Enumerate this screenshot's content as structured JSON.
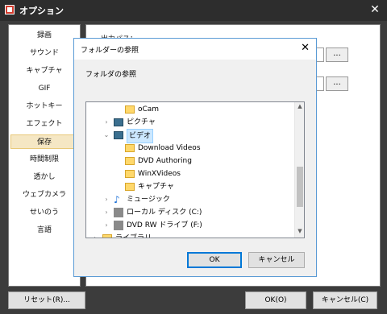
{
  "window": {
    "title": "オプション",
    "close": "✕"
  },
  "sidebar": {
    "items": [
      {
        "label": "録画"
      },
      {
        "label": "サウンド"
      },
      {
        "label": "キャプチャ"
      },
      {
        "label": "GIF"
      },
      {
        "label": "ホットキー"
      },
      {
        "label": "エフェクト"
      },
      {
        "label": "保存",
        "selected": true
      },
      {
        "label": "時間制限"
      },
      {
        "label": "透かし"
      },
      {
        "label": "ウェブカメラ"
      },
      {
        "label": "せいのう"
      },
      {
        "label": "言語"
      }
    ]
  },
  "panel": {
    "label": "出力パス：",
    "browse_label": "..."
  },
  "main_buttons": {
    "reset": "リセット(R)...",
    "ok": "OK(O)",
    "cancel": "キャンセル(C)"
  },
  "dialog": {
    "title": "フォルダーの参照",
    "close": "✕",
    "description": "フォルダの参照",
    "tree": [
      {
        "label": "oCam",
        "depth": 2,
        "icon": "folder-icon",
        "expander": ""
      },
      {
        "label": "ピクチャ",
        "depth": 1,
        "icon": "pictures-folder-icon",
        "expander": "›"
      },
      {
        "label": "ビデオ",
        "depth": 1,
        "icon": "videos-folder-icon",
        "expander": "⌄",
        "selected": true
      },
      {
        "label": "Download Videos",
        "depth": 2,
        "icon": "folder-icon",
        "expander": ""
      },
      {
        "label": "DVD Authoring",
        "depth": 2,
        "icon": "folder-icon",
        "expander": ""
      },
      {
        "label": "WinXVideos",
        "depth": 2,
        "icon": "folder-icon",
        "expander": ""
      },
      {
        "label": "キャプチャ",
        "depth": 2,
        "icon": "folder-icon",
        "expander": ""
      },
      {
        "label": "ミュージック",
        "depth": 1,
        "icon": "music-icon",
        "expander": "›"
      },
      {
        "label": "ローカル ディスク (C:)",
        "depth": 1,
        "icon": "drive-icon",
        "expander": "›"
      },
      {
        "label": "DVD RW ドライブ (F:)",
        "depth": 1,
        "icon": "dvd-drive-icon",
        "expander": "›"
      },
      {
        "label": "ライブラリ",
        "depth": 0,
        "icon": "library-icon",
        "expander": "›"
      }
    ],
    "ok": "OK",
    "cancel": "キャンセル"
  },
  "colors": {
    "selection_bg": "#cce8ff",
    "sidebar_selected": "#f5e7c4",
    "dialog_border": "#5b9bd5"
  }
}
